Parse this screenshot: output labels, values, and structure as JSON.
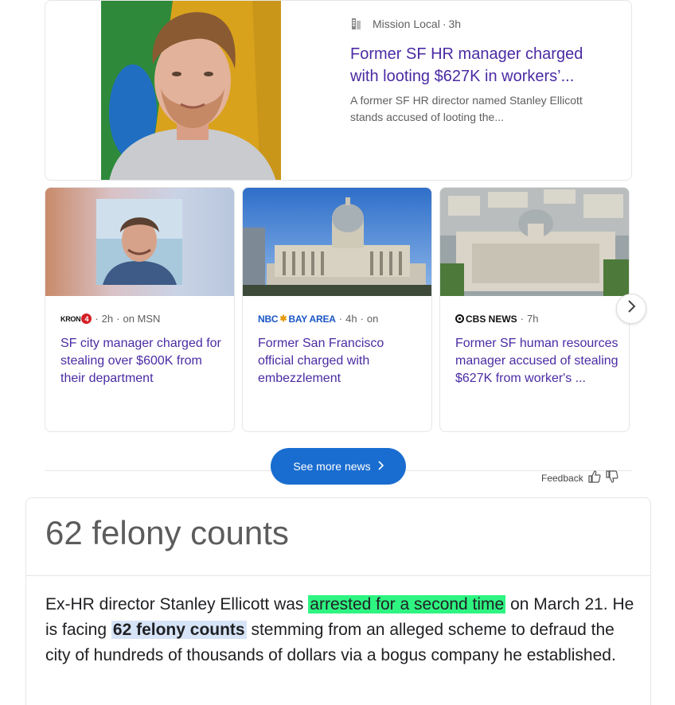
{
  "top_story": {
    "source": "Mission Local",
    "age": "3h",
    "title": "Former SF HR manager charged with looting $627K in workers’...",
    "snippet": "A former SF HR director named Stanley Ellicott stands accused of looting the..."
  },
  "cards": [
    {
      "source_logo": "KRON",
      "source_logo_num": "4",
      "age": "2h",
      "via": "on MSN",
      "title": "SF city manager charged for stealing over $600K from their department"
    },
    {
      "source_logo_left": "NBC",
      "source_logo_right": "BAY AREA",
      "age": "4h",
      "via": "on",
      "title": "Former San Francisco official charged with embezzlement"
    },
    {
      "source_logo": "CBS NEWS",
      "age": "7h",
      "title": "Former SF human resources manager accused of stealing $627K from worker's ..."
    }
  ],
  "separator": "·",
  "see_more_label": "See more news",
  "feedback_label": "Feedback",
  "answer": {
    "title": "62 felony counts",
    "body_1": "Ex-HR director Stanley Ellicott was",
    "highlight_1": "arrested for a second time",
    "body_2": "on March 21. He is facing",
    "highlight_2": "62 felony counts",
    "body_3": "stemming from an alleged scheme to defraud the city of hundreds of thousands of dollars via a bogus company he established."
  },
  "colors": {
    "link_purple": "#4b2ba3",
    "button_blue": "#1a6dd0",
    "highlight_green": "#2ef581",
    "highlight_blue": "#d7e4f7"
  },
  "icons": {
    "next": "chevron-right-icon",
    "thumbs_up": "thumbs-up-icon",
    "thumbs_down": "thumbs-down-icon"
  }
}
